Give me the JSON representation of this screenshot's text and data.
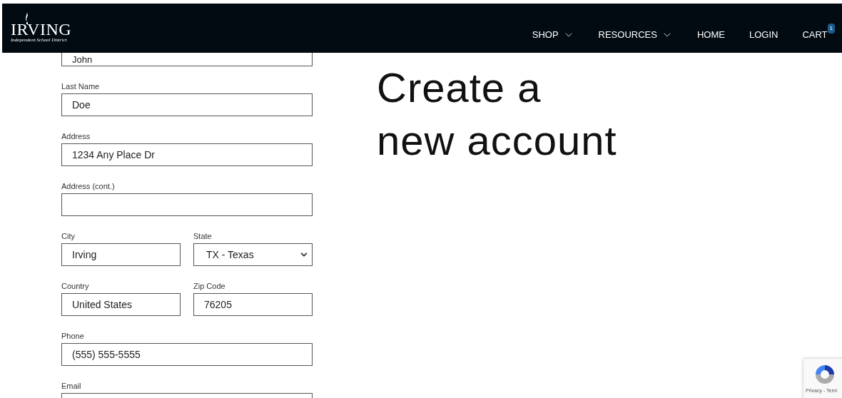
{
  "header": {
    "logo": {
      "name": "IRVING",
      "subtitle": "Independent School District"
    },
    "nav": [
      {
        "label": "SHOP",
        "dropdown": true
      },
      {
        "label": "RESOURCES",
        "dropdown": true
      },
      {
        "label": "HOME",
        "dropdown": false
      },
      {
        "label": "LOGIN",
        "dropdown": false
      },
      {
        "label": "CART",
        "dropdown": false,
        "badge": "1"
      }
    ]
  },
  "form": {
    "rows": [
      [
        {
          "kind": "text",
          "value": "John"
        }
      ],
      [
        {
          "kind": "text",
          "label": "Last Name",
          "value": "Doe"
        }
      ],
      [
        {
          "kind": "text",
          "label": "Address",
          "value": "1234 Any Place Dr"
        }
      ],
      [
        {
          "kind": "text",
          "label": "Address (cont.)"
        }
      ],
      [
        {
          "kind": "text",
          "label": "City",
          "value": "Irving"
        },
        {
          "kind": "select",
          "label": "State",
          "value": "TX - Texas"
        }
      ],
      [
        {
          "kind": "text",
          "label": "Country",
          "value": "United States"
        },
        {
          "kind": "text",
          "label": "Zip Code",
          "value": "76205"
        }
      ],
      [
        {
          "kind": "text",
          "label": "Phone",
          "value": "(555) 555-5555"
        }
      ],
      [
        {
          "kind": "text",
          "label": "Email"
        }
      ]
    ]
  },
  "heading": [
    "Create a",
    "new account"
  ],
  "recaptcha": {
    "links": "Privacy - Term"
  }
}
